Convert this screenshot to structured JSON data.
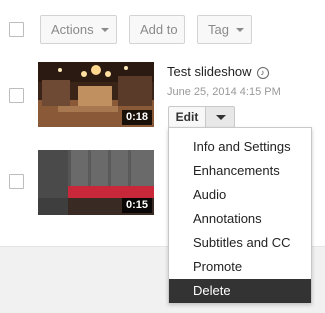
{
  "toolbar": {
    "actions_label": "Actions",
    "add_to_label": "Add to",
    "tag_label": "Tag"
  },
  "videos": [
    {
      "title": "Test slideshow",
      "date": "June 25, 2014 4:15 PM",
      "duration": "0:18",
      "edit_label": "Edit"
    },
    {
      "duration": "0:15"
    }
  ],
  "edit_menu": {
    "items": [
      "Info and Settings",
      "Enhancements",
      "Audio",
      "Annotations",
      "Subtitles and CC",
      "Promote",
      "Delete"
    ],
    "selected": "Delete"
  },
  "colors": {
    "menu_selected_bg": "#333333",
    "footer_bg": "#f1f1f1"
  },
  "icons": {
    "music": "music-note-icon"
  }
}
